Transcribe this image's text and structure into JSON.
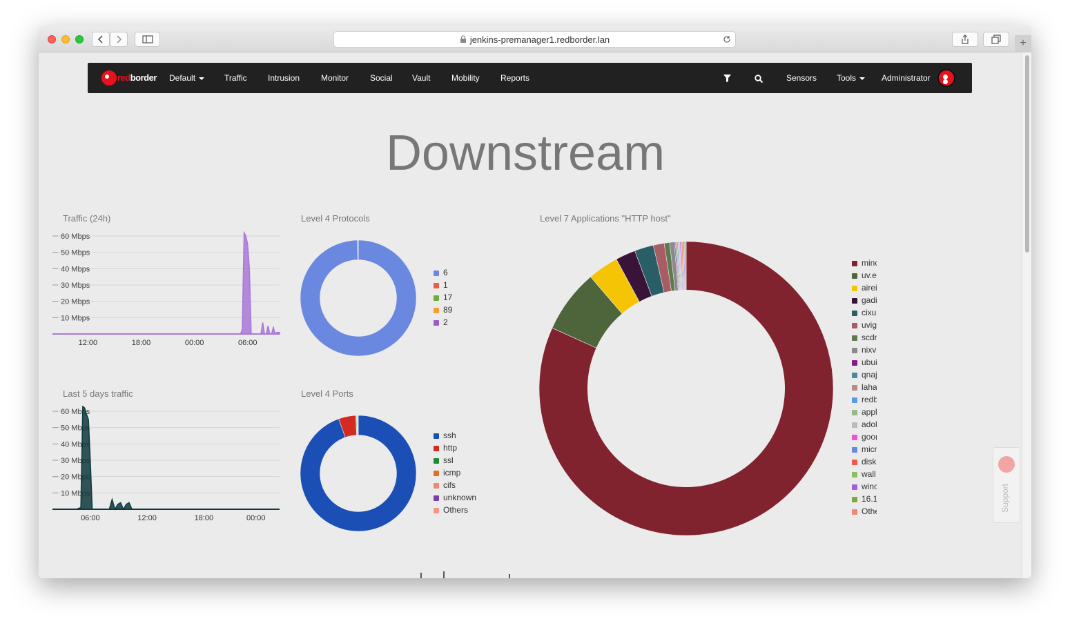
{
  "browser": {
    "url": "jenkins-premanager1.redborder.lan",
    "back_icon": "chevron-left-icon",
    "forward_icon": "chevron-right-icon",
    "sidebar_icon": "sidebar-icon",
    "share_icon": "share-icon",
    "tabs_icon": "tabs-icon",
    "new_tab_label": "+"
  },
  "navbar": {
    "logo_red": "red",
    "logo_white": "border",
    "items": [
      "Default",
      "Traffic",
      "Intrusion",
      "Monitor",
      "Social",
      "Vault",
      "Mobility",
      "Reports"
    ],
    "filter_icon": "filter-icon",
    "search_icon": "search-icon",
    "sensors": "Sensors",
    "tools": "Tools",
    "user": "Administrator"
  },
  "page": {
    "title": "Downstream"
  },
  "widgets": {
    "traffic24h": {
      "title": "Traffic (24h)"
    },
    "last5days": {
      "title": "Last 5 days traffic"
    },
    "l4protocols": {
      "title": "Level 4 Protocols"
    },
    "l4ports": {
      "title": "Level 4 Ports"
    },
    "l7apps": {
      "title": "Level 7 Applications \"HTTP host\""
    }
  },
  "chart_data": [
    {
      "id": "traffic24h",
      "type": "area",
      "title": "Traffic (24h)",
      "color": "#a978d8",
      "y_ticks": [
        "10 Mbps",
        "20 Mbps",
        "30 Mbps",
        "40 Mbps",
        "50 Mbps",
        "60 Mbps"
      ],
      "x_ticks": [
        "12:00",
        "18:00",
        "00:00",
        "06:00"
      ],
      "ylim": [
        0,
        60
      ],
      "x_hours": [
        8,
        12,
        18,
        24,
        29.2,
        29.4,
        29.6,
        29.8,
        30.0,
        30.2,
        30.4,
        30.6,
        30.8,
        31.0,
        31.5,
        31.7,
        31.9,
        32.1,
        32.3,
        32.5,
        32.7,
        32.9,
        33.1,
        33.3,
        33.6
      ],
      "values": [
        0,
        0,
        0,
        0,
        0,
        3,
        62,
        60,
        55,
        40,
        0,
        0,
        0,
        0,
        0,
        7,
        0,
        0,
        5,
        0,
        0,
        4,
        0,
        1,
        1
      ]
    },
    {
      "id": "last5days",
      "type": "area",
      "title": "Last 5 days traffic",
      "color": "#0f3a3c",
      "y_ticks": [
        "10 Mbps",
        "20 Mbps",
        "30 Mbps",
        "40 Mbps",
        "50 Mbps",
        "60 Mbps"
      ],
      "x_ticks": [
        "06:00",
        "12:00",
        "18:00",
        "00:00"
      ],
      "ylim": [
        0,
        60
      ],
      "x_hours": [
        2,
        4.5,
        5.0,
        5.2,
        5.4,
        5.6,
        5.8,
        6.0,
        6.2,
        6.4,
        8.0,
        8.3,
        8.6,
        8.9,
        9.2,
        9.5,
        9.8,
        10.1,
        10.4,
        11,
        20,
        26
      ],
      "values": [
        0,
        0,
        1,
        63,
        62,
        58,
        55,
        30,
        0,
        0,
        0,
        6,
        0,
        3,
        4,
        0,
        3,
        4,
        0,
        0,
        0,
        0
      ]
    },
    {
      "id": "l4protocols",
      "type": "pie",
      "title": "Level 4 Protocols",
      "labels": [
        "6",
        "1",
        "17",
        "89",
        "2"
      ],
      "values": [
        99.8,
        0.05,
        0.1,
        0.03,
        0.02
      ],
      "colors": [
        "#6b88e0",
        "#f05a4a",
        "#6aae3c",
        "#f0a030",
        "#9c5cd0"
      ]
    },
    {
      "id": "l4ports",
      "type": "pie",
      "title": "Level 4 Ports",
      "labels": [
        "ssh",
        "http",
        "ssl",
        "icmp",
        "cifs",
        "unknown",
        "Others"
      ],
      "values": [
        94.5,
        4.8,
        0.2,
        0.1,
        0.1,
        0.1,
        0.2
      ],
      "colors": [
        "#1b4fb5",
        "#d32b1f",
        "#1e8a32",
        "#e07020",
        "#f08870",
        "#7a3fa8",
        "#f59585"
      ]
    },
    {
      "id": "l7apps",
      "type": "pie",
      "title": "Level 7 Applications \"HTTP host\"",
      "labels": [
        "minc",
        "uv.e",
        "airei",
        "gadi",
        "cixu",
        "uvig",
        "scdr",
        "nixv",
        "ubui",
        "qnaj",
        "laha",
        "redb",
        "appl",
        "adol",
        "goo(",
        "micr",
        "disk",
        "wall",
        "winc",
        "16.1",
        "Othe"
      ],
      "values": [
        82.0,
        7.0,
        3.4,
        2.2,
        2.1,
        1.2,
        0.6,
        0.5,
        0.1,
        0.1,
        0.1,
        0.1,
        0.1,
        0.1,
        0.1,
        0.1,
        0.1,
        0.1,
        0.1,
        0.1,
        0.1
      ],
      "colors": [
        "#80232f",
        "#4e653b",
        "#f5c405",
        "#3a1438",
        "#2a5e66",
        "#a85c64",
        "#607a50",
        "#8a8a8a",
        "#881a88",
        "#4a8a98",
        "#bb8888",
        "#5a9ae8",
        "#9ab88a",
        "#bbbbbb",
        "#f050d8",
        "#6a88e0",
        "#f05a4a",
        "#8ac060",
        "#a060d8",
        "#7aaa3a",
        "#f08878"
      ]
    }
  ]
}
